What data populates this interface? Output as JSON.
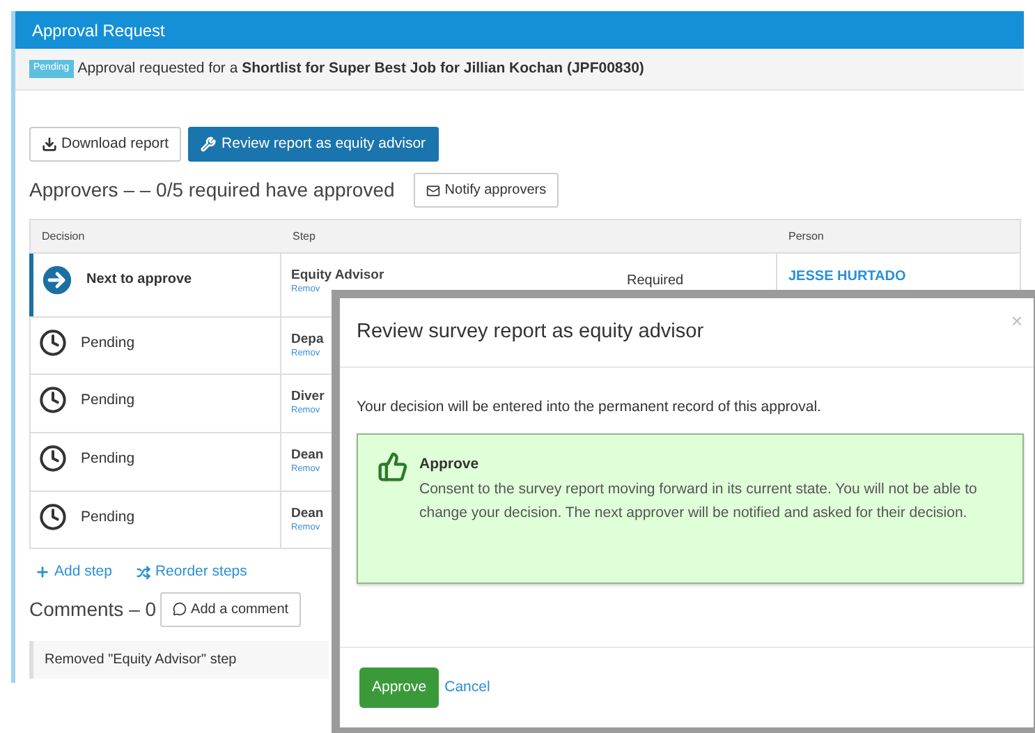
{
  "panel": {
    "title": "Approval Request",
    "status_badge": "Pending",
    "request_text": "Approval requested for a **Shortlist for Super Best Job for Jillian Kochan (JPF00830)**"
  },
  "actions": [
    "Download report",
    "Review report as equity advisor"
  ],
  "approvers": {
    "heading": "Approvers – – 0/5 required have approved",
    "notify_button": "Notify approvers"
  },
  "table": {
    "columns": [
      "Decision",
      "Step",
      "",
      "Person"
    ],
    "rows": [
      {
        "kind": "next",
        "decision": "Next to approve",
        "step": "Equity Advisor",
        "step_link": "Remov",
        "requirement": "Required",
        "person": "JESSE HURTADO"
      },
      {
        "kind": "pending",
        "decision": "Pending",
        "step": "Depa",
        "step_link": "Remov"
      },
      {
        "kind": "pending",
        "decision": "Pending",
        "step": "Diver",
        "step_link": "Remov"
      },
      {
        "kind": "pending",
        "decision": "Pending",
        "step": "Dean",
        "step_link": "Remov"
      },
      {
        "kind": "pending",
        "decision": "Pending",
        "step": "Dean",
        "step_link": "Remov"
      }
    ]
  },
  "step_links": [
    "Add step",
    "Reorder steps"
  ],
  "comments": {
    "heading": "Comments – 0",
    "add_button": "Add a comment",
    "entries": [
      "Removed \"Equity Advisor\" step"
    ]
  },
  "modal": {
    "title": "Review survey report as equity advisor",
    "close": "×",
    "intro": "Your decision will be entered into the permanent record of this approval.",
    "option": {
      "title": "Approve",
      "description": "Consent to the survey report moving forward in its current state. You will not be able to change your decision. The next approver will be notified and asked for their decision."
    },
    "buttons": [
      "Approve",
      "Cancel"
    ]
  }
}
